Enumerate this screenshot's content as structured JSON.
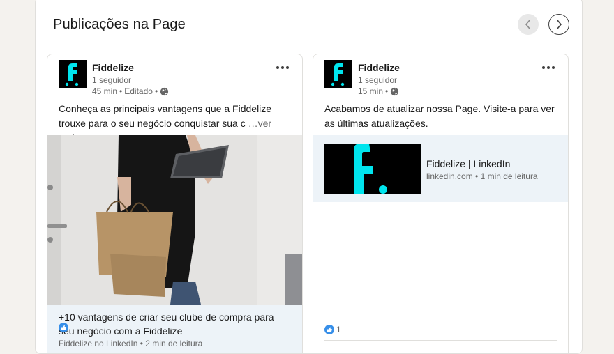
{
  "panel": {
    "title": "Publicações na Page",
    "prev_icon": "chevron-left-icon",
    "next_icon": "chevron-right-icon"
  },
  "posts": [
    {
      "author": "Fiddelize",
      "followers": "1 seguidor",
      "time": "45 min",
      "edited": "Editado",
      "text": "Conheça as principais vantagens que a Fiddelize trouxe para o seu negócio conquistar sua c",
      "see_more": "…ver mais",
      "article_title": "+10 vantagens de criar seu clube de compra para seu negócio com a Fiddelize",
      "article_sub": "Fiddelize no LinkedIn • 2 min de leitura",
      "visibility_icon": "globe-icon"
    },
    {
      "author": "Fiddelize",
      "followers": "1 seguidor",
      "time": "15 min",
      "text": "Acabamos de atualizar nossa Page. Visite-a para ver as últimas atualizações.",
      "link_title": "Fiddelize | LinkedIn",
      "link_sub": "linkedin.com • 1 min de leitura",
      "reaction_count": "1",
      "visibility_icon": "globe-icon"
    }
  ],
  "colors": {
    "logo_cyan": "#00e5ee",
    "like_blue": "#378fe9"
  }
}
